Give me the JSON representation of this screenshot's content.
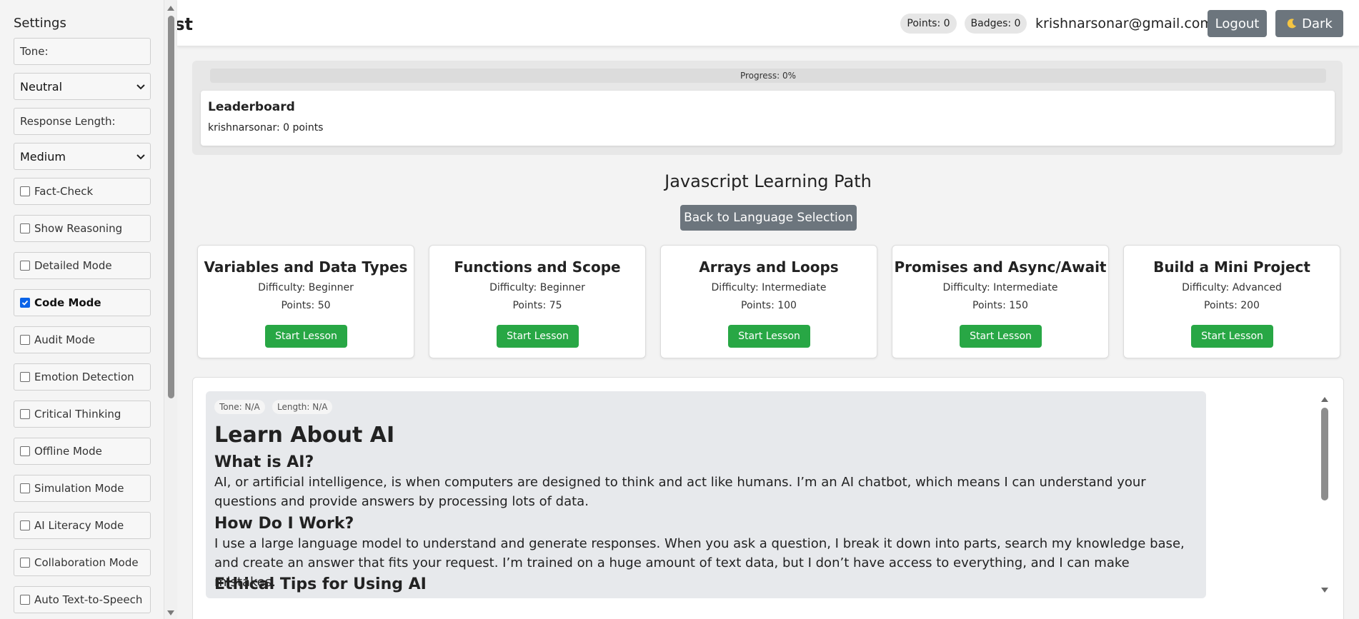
{
  "sidebar": {
    "title": "Settings",
    "tone_label": "Tone:",
    "tone_value": "Neutral",
    "length_label": "Response Length:",
    "length_value": "Medium",
    "options": [
      {
        "label": "Fact-Check",
        "checked": false
      },
      {
        "label": "Show Reasoning",
        "checked": false
      },
      {
        "label": "Detailed Mode",
        "checked": false
      },
      {
        "label": "Code Mode",
        "checked": true
      },
      {
        "label": "Audit Mode",
        "checked": false
      },
      {
        "label": "Emotion Detection",
        "checked": false
      },
      {
        "label": "Critical Thinking",
        "checked": false
      },
      {
        "label": "Offline Mode",
        "checked": false
      },
      {
        "label": "Simulation Mode",
        "checked": false
      },
      {
        "label": "AI Literacy Mode",
        "checked": false
      },
      {
        "label": "Collaboration Mode",
        "checked": false
      },
      {
        "label": "Auto Text-to-Speech",
        "checked": false
      }
    ]
  },
  "header": {
    "title_fragment": "st",
    "points": "Points: 0",
    "badges": "Badges: 0",
    "email": "krishnarsonar@gmail.com",
    "logout": "Logout",
    "theme_icon": "moon-icon",
    "theme": "Dark"
  },
  "progress": {
    "label": "Progress: 0%",
    "value": 0
  },
  "leaderboard": {
    "title": "Leaderboard",
    "entries": [
      "krishnarsonar: 0 points"
    ]
  },
  "learning_path": {
    "title": "Javascript Learning Path",
    "back_button": "Back to Language Selection",
    "lessons": [
      {
        "title": "Variables and Data Types",
        "difficulty": "Difficulty: Beginner",
        "points": "Points: 50",
        "button": "Start Lesson"
      },
      {
        "title": "Functions and Scope",
        "difficulty": "Difficulty: Beginner",
        "points": "Points: 75",
        "button": "Start Lesson"
      },
      {
        "title": "Arrays and Loops",
        "difficulty": "Difficulty: Intermediate",
        "points": "Points: 100",
        "button": "Start Lesson"
      },
      {
        "title": "Promises and Async/Await",
        "difficulty": "Difficulty: Intermediate",
        "points": "Points: 150",
        "button": "Start Lesson"
      },
      {
        "title": "Build a Mini Project",
        "difficulty": "Difficulty: Advanced",
        "points": "Points: 200",
        "button": "Start Lesson"
      }
    ]
  },
  "chat": {
    "tone_tag": "Tone: N/A",
    "length_tag": "Length: N/A",
    "heading": "Learn About AI",
    "sections": [
      {
        "heading": "What is AI?",
        "body": "AI, or artificial intelligence, is when computers are designed to think and act like humans. I’m an AI chatbot, which means I can understand your questions and provide answers by processing lots of data."
      },
      {
        "heading": "How Do I Work?",
        "body": "I use a large language model to understand and generate responses. When you ask a question, I break it down into parts, search my knowledge base, and create an answer that fits your request. I’m trained on a huge amount of text data, but I don’t have access to everything, and I can make mistakes."
      },
      {
        "heading": "Ethical Tips for Using AI",
        "body": ""
      }
    ]
  },
  "colors": {
    "accent_green": "#28a745",
    "button_gray": "#6c757d",
    "checkbox_blue": "#0a63e8"
  }
}
